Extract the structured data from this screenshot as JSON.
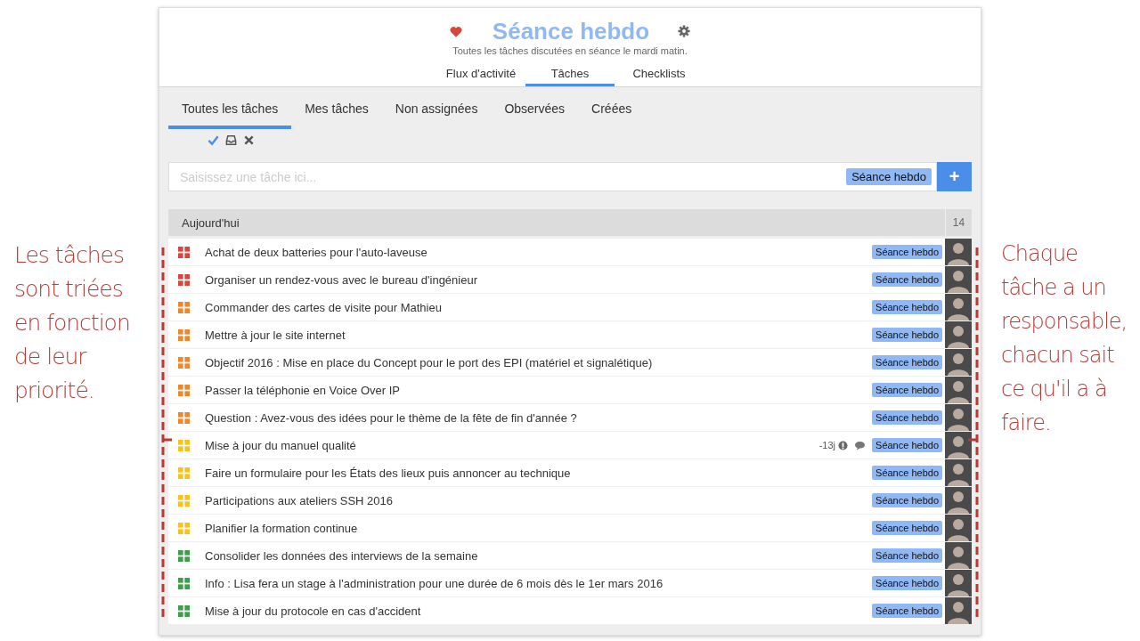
{
  "header": {
    "title": "Séance hebdo",
    "subtitle": "Toutes les tâches discutées en séance le mardi matin."
  },
  "tabs": [
    {
      "label": "Flux d'activité",
      "selected": false
    },
    {
      "label": "Tâches",
      "selected": true
    },
    {
      "label": "Checklists",
      "selected": false
    }
  ],
  "subtabs": [
    {
      "label": "Toutes les tâches",
      "selected": true
    },
    {
      "label": "Mes tâches",
      "selected": false
    },
    {
      "label": "Non assignées",
      "selected": false
    },
    {
      "label": "Observées",
      "selected": false
    },
    {
      "label": "Créées",
      "selected": false
    }
  ],
  "new_task": {
    "placeholder": "Saisissez une tâche ici...",
    "tag": "Séance hebdo",
    "add_button": "+"
  },
  "group": {
    "title": "Aujourd'hui",
    "count": "14"
  },
  "tasks": [
    {
      "title": "Achat de deux batteries pour l'auto-laveuse",
      "color": "#d9453a",
      "tag": "Séance hebdo"
    },
    {
      "title": "Organiser un rendez-vous avec le bureau d'ingénieur",
      "color": "#d9453a",
      "tag": "Séance hebdo"
    },
    {
      "title": "Commander des cartes de visite pour Mathieu",
      "color": "#f0862a",
      "tag": "Séance hebdo"
    },
    {
      "title": "Mettre à jour le site internet",
      "color": "#f0862a",
      "tag": "Séance hebdo"
    },
    {
      "title": "Objectif 2016 : Mise en place du Concept pour le port des EPI (matériel et signalétique)",
      "color": "#f0862a",
      "tag": "Séance hebdo"
    },
    {
      "title": "Passer la téléphonie en Voice Over IP",
      "color": "#f0862a",
      "tag": "Séance hebdo"
    },
    {
      "title": "Question : Avez-vous des idées pour le thème de la fête de fin d'année ?",
      "color": "#f0862a",
      "tag": "Séance hebdo"
    },
    {
      "title": "Mise à jour du manuel qualité",
      "color": "#f8c21c",
      "tag": "Séance hebdo",
      "due": "-13j",
      "info": true,
      "comments": true
    },
    {
      "title": "Faire un formulaire pour les États des lieux puis annoncer au technique",
      "color": "#f8c21c",
      "tag": "Séance hebdo"
    },
    {
      "title": "Participations aux ateliers SSH 2016",
      "color": "#f8c21c",
      "tag": "Séance hebdo"
    },
    {
      "title": "Planifier la formation continue",
      "color": "#f8c21c",
      "tag": "Séance hebdo"
    },
    {
      "title": "Consolider les données des interviews de la semaine",
      "color": "#3aa04a",
      "tag": "Séance hebdo"
    },
    {
      "title": "Info : Lisa fera un stage à l'administration pour une durée de 6 mois dès le 1er mars 2016",
      "color": "#3aa04a",
      "tag": "Séance hebdo"
    },
    {
      "title": "Mise à jour du protocole en cas d'accident",
      "color": "#3aa04a",
      "tag": "Séance hebdo"
    }
  ],
  "annotations": {
    "left": "Les tâches\nsont triées\nen fonction\nde leur\npriorité.",
    "right": "Chaque\ntâche a un\nresponsable,\nchacun sait\nce qu'il a à\nfaire."
  }
}
